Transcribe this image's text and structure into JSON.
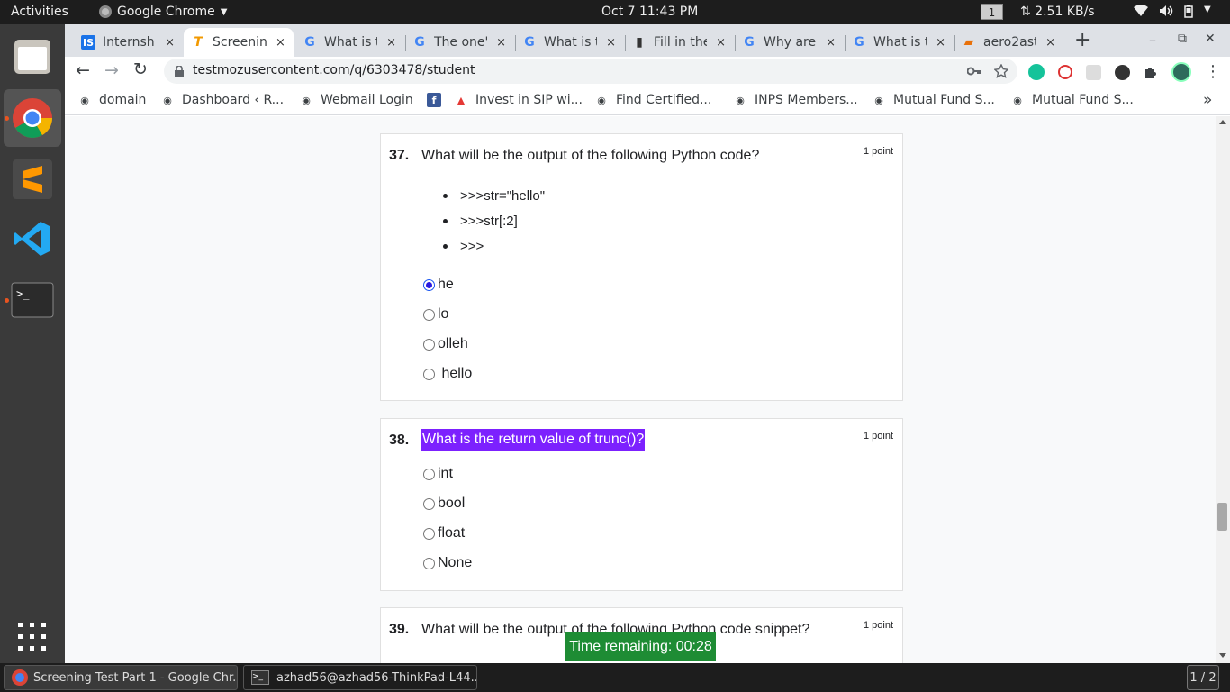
{
  "system": {
    "activities": "Activities",
    "app_name": "Google Chrome",
    "clock": "Oct 7  11:43 PM",
    "workspace": "1",
    "netspeed": "⇅ 2.51 KB/s"
  },
  "tabs": [
    {
      "title": "Internsh",
      "icon": "IS",
      "icon_bg": "#1a73e8",
      "icon_fg": "#fff",
      "close": "×"
    },
    {
      "title": "Screenin",
      "icon": "T",
      "icon_bg": "#fff",
      "icon_fg": "#f29900",
      "close": "×"
    },
    {
      "title": "What is t",
      "icon": "G",
      "icon_bg": "#fff",
      "icon_fg": "#4285f4",
      "close": "×"
    },
    {
      "title": "The one'",
      "icon": "G",
      "icon_bg": "#fff",
      "icon_fg": "#4285f4",
      "close": "×"
    },
    {
      "title": "What is t",
      "icon": "G",
      "icon_bg": "#fff",
      "icon_fg": "#4285f4",
      "close": "×"
    },
    {
      "title": "Fill in the",
      "icon": "▮",
      "icon_bg": "#fff",
      "icon_fg": "#333",
      "close": "×"
    },
    {
      "title": "Why are",
      "icon": "G",
      "icon_bg": "#fff",
      "icon_fg": "#4285f4",
      "close": "×"
    },
    {
      "title": "What is t",
      "icon": "G",
      "icon_bg": "#fff",
      "icon_fg": "#4285f4",
      "close": "×"
    },
    {
      "title": "aero2ast",
      "icon": "▰",
      "icon_bg": "#fff",
      "icon_fg": "#e8710a",
      "close": "×"
    }
  ],
  "new_tab": "+",
  "window_controls": {
    "minimize": "–",
    "restore": "⧉",
    "close": "✕"
  },
  "nav": {
    "back": "←",
    "forward": "→",
    "reload": "↻"
  },
  "url": "testmozusercontent.com/q/6303478/student",
  "bookmarks": [
    {
      "label": "domain",
      "icon": "◉",
      "bg": "#fff",
      "fg": "#3c4043"
    },
    {
      "label": "Dashboard ‹ R...",
      "icon": "◉",
      "bg": "#fff",
      "fg": "#3c4043"
    },
    {
      "label": "Webmail Login",
      "icon": "◉",
      "bg": "#fff",
      "fg": "#3c4043"
    },
    {
      "label": "",
      "icon": "f",
      "bg": "#3b5998",
      "fg": "#fff"
    },
    {
      "label": "Invest in SIP wi...",
      "icon": "▲",
      "bg": "#fff",
      "fg": "#e53935"
    },
    {
      "label": "Find Certified...",
      "icon": "◉",
      "bg": "#fff",
      "fg": "#3c4043"
    },
    {
      "label": "INPS Members...",
      "icon": "◉",
      "bg": "#fff",
      "fg": "#3c4043"
    },
    {
      "label": "Mutual Fund S...",
      "icon": "◉",
      "bg": "#fff",
      "fg": "#3c4043"
    },
    {
      "label": "Mutual Fund S...",
      "icon": "◉",
      "bg": "#fff",
      "fg": "#3c4043"
    }
  ],
  "bookmarks_more": "»",
  "questions": [
    {
      "number": "37.",
      "text": "What will be the output of the following Python code?",
      "points": "1 point",
      "code": [
        ">>>str=\"hello\"",
        ">>>str[:2]",
        ">>>"
      ],
      "options": [
        "he",
        "lo",
        "olleh",
        " hello"
      ],
      "selected": 0
    },
    {
      "number": "38.",
      "text": "What is the return value of trunc()?",
      "points": "1 point",
      "options": [
        "int",
        "bool",
        "float",
        "None"
      ],
      "selected": -1
    },
    {
      "number": "39.",
      "text": "What will be the output of the following Python code snippet?",
      "points": "1 point"
    }
  ],
  "timer": "Time remaining: 00:28",
  "taskbar": {
    "window1": "Screening Test Part 1 - Google Chr...",
    "window2": "azhad56@azhad56-ThinkPad-L44...",
    "pager": "1 / 2"
  }
}
